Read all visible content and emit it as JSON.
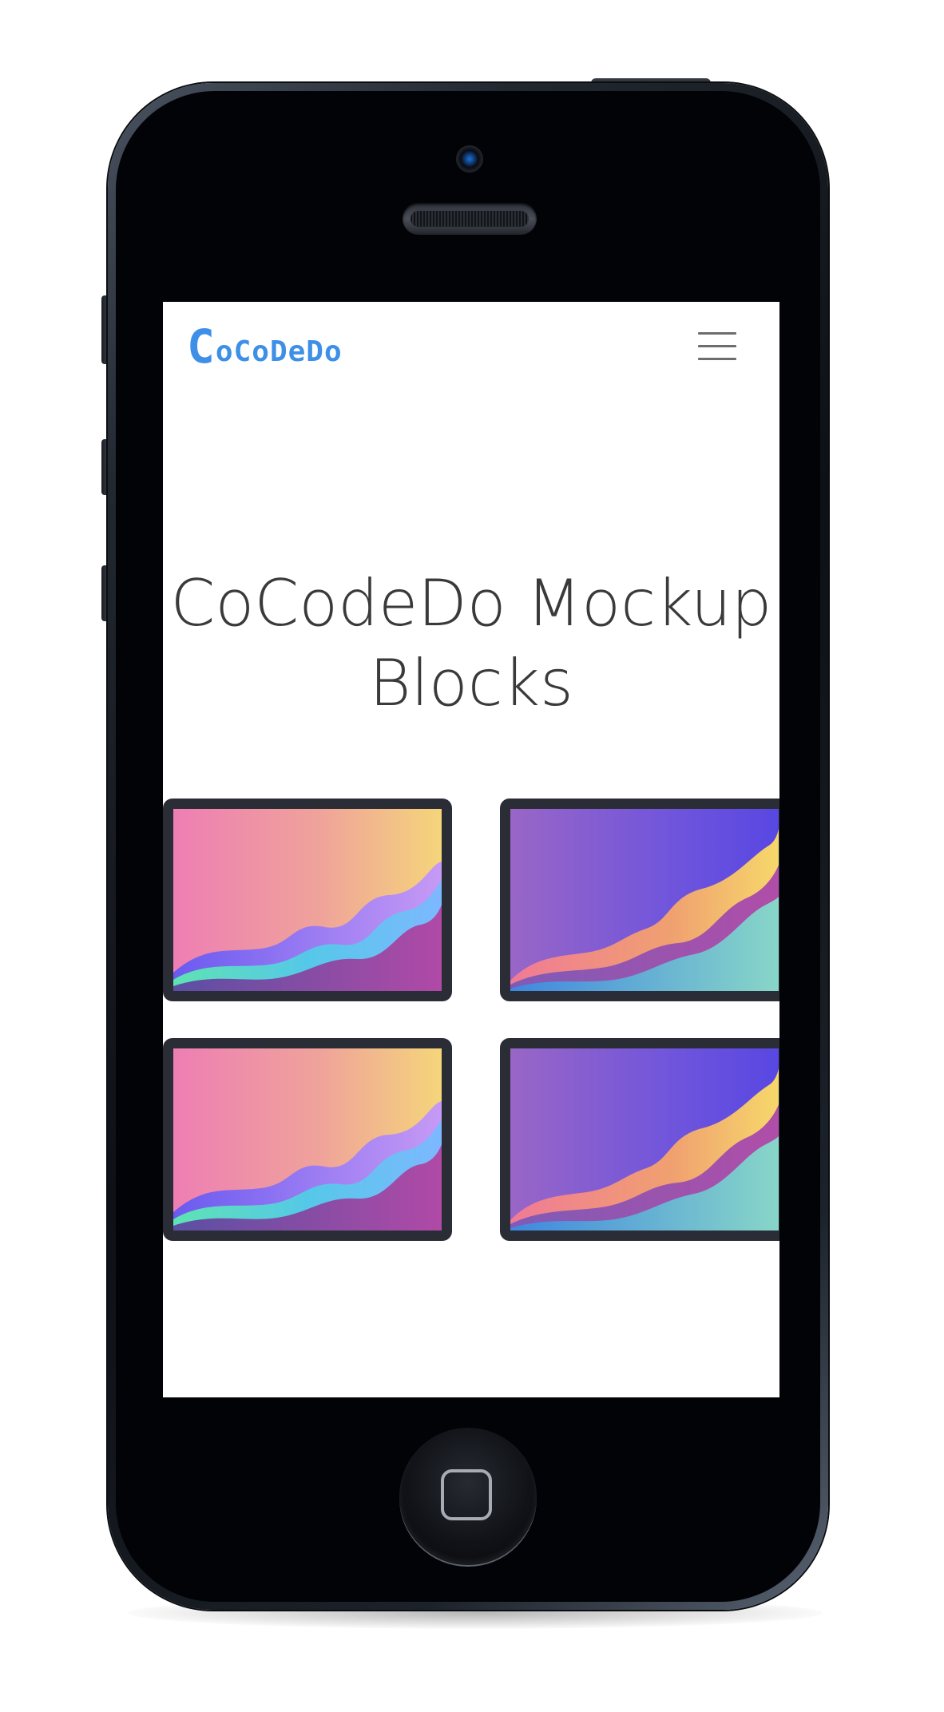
{
  "navbar": {
    "brand_first": "C",
    "brand_rest": "oCoDeDo",
    "menu_icon": "hamburger-menu-icon"
  },
  "hero": {
    "title": "CoCodeDo Mockup Blocks"
  },
  "mockups": [
    {
      "variant": "warm",
      "gradient": [
        "#f07eb5",
        "#f4d37a"
      ]
    },
    {
      "variant": "cool",
      "gradient": [
        "#9a64c8",
        "#5b4ee0"
      ]
    },
    {
      "variant": "warm",
      "gradient": [
        "#f07eb5",
        "#f4d37a"
      ]
    },
    {
      "variant": "cool",
      "gradient": [
        "#9a64c8",
        "#5b4ee0"
      ]
    }
  ],
  "colors": {
    "brand": "#3d8fe8",
    "title": "#3a3a3a",
    "card_border": "#2b2d36",
    "phone_body": "#0d1014"
  },
  "device": {
    "home_icon": "home-button-icon",
    "camera_icon": "camera-icon",
    "speaker_icon": "speaker-icon"
  }
}
